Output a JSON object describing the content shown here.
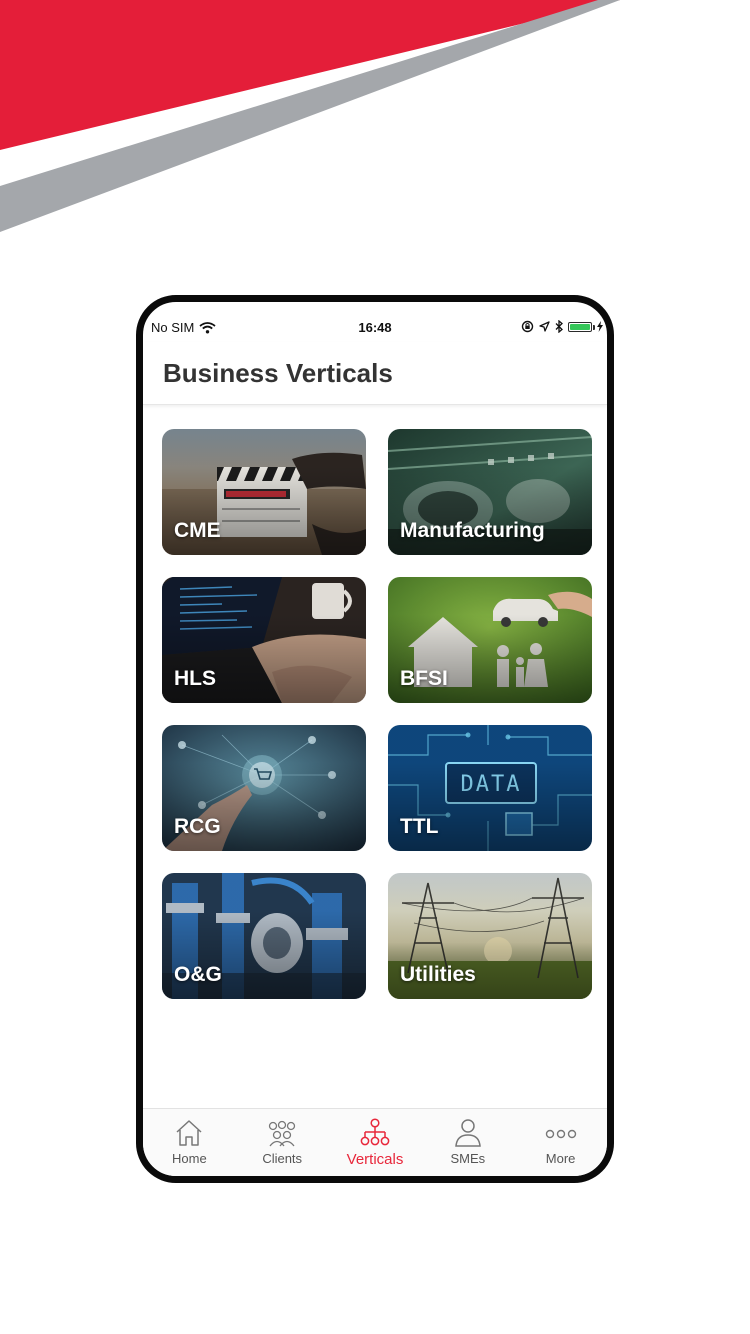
{
  "brand": {
    "accent": "#e41e39",
    "stripe": "#a4a7ab"
  },
  "status_bar": {
    "carrier": "No SIM",
    "time": "16:48",
    "icons": [
      "wifi-icon",
      "lock-rotation-icon",
      "location-arrow-icon",
      "bluetooth-icon",
      "battery-icon"
    ],
    "battery_fraction": 1.0
  },
  "header": {
    "title": "Business Verticals"
  },
  "verticals": [
    {
      "label": "CME",
      "image": "film-clapperboard-photo"
    },
    {
      "label": "Manufacturing",
      "image": "factory-production-line-photo"
    },
    {
      "label": "HLS",
      "image": "laptop-typing-photo"
    },
    {
      "label": "BFSI",
      "image": "paper-family-house-car-photo"
    },
    {
      "label": "RCG",
      "image": "digital-shopping-cart-photo"
    },
    {
      "label": "TTL",
      "image": "data-circuit-board-photo"
    },
    {
      "label": "O&G",
      "image": "pipes-valves-plant-photo"
    },
    {
      "label": "Utilities",
      "image": "power-lines-sunset-photo"
    }
  ],
  "tab_bar": {
    "active_color": "#e8273b",
    "items": [
      {
        "label": "Home",
        "icon": "home-icon",
        "active": false
      },
      {
        "label": "Clients",
        "icon": "clients-icon",
        "active": false
      },
      {
        "label": "Verticals",
        "icon": "verticals-hierarchy-icon",
        "active": true
      },
      {
        "label": "SMEs",
        "icon": "user-icon",
        "active": false
      },
      {
        "label": "More",
        "icon": "more-dots-icon",
        "active": false
      }
    ]
  }
}
